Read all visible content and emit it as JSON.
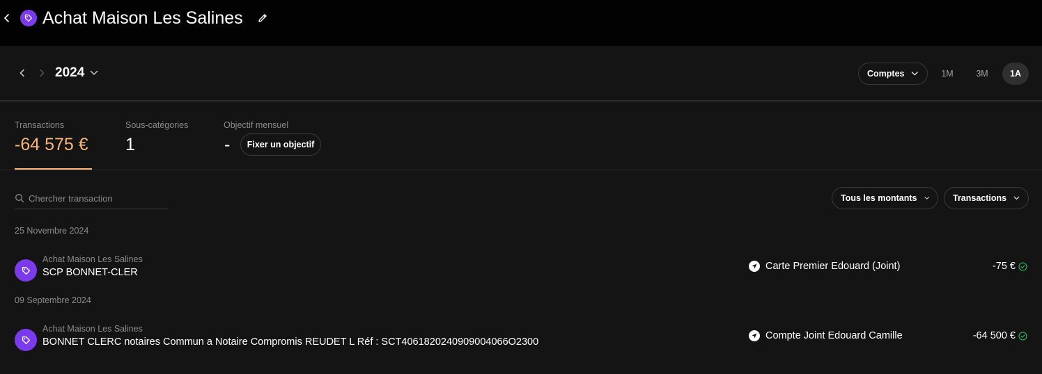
{
  "header": {
    "title": "Achat Maison Les Salines",
    "icon": "tag-icon",
    "accent_color": "#7c3aed"
  },
  "period": {
    "year": "2024",
    "accounts_filter": "Comptes",
    "options": [
      "1M",
      "3M",
      "1A"
    ],
    "active_option": "1A"
  },
  "stats": {
    "transactions_label": "Transactions",
    "transactions_value": "-64 575 €",
    "subcategories_label": "Sous-catégories",
    "subcategories_value": "1",
    "goal_label": "Objectif mensuel",
    "goal_value": "-",
    "goal_button": "Fixer un objectif",
    "amount_color": "#f9b57a"
  },
  "filters": {
    "search_placeholder": "Chercher transaction",
    "amounts": "Tous les montants",
    "type": "Transactions"
  },
  "groups": [
    {
      "date": "25 Novembre 2024",
      "transactions": [
        {
          "category": "Achat Maison Les Salines",
          "label": "SCP BONNET-CLER",
          "account": "Carte Premier Edouard (Joint)",
          "amount": "-75 €",
          "status": "check-circle-icon"
        }
      ]
    },
    {
      "date": "09 Septembre 2024",
      "transactions": [
        {
          "category": "Achat Maison Les Salines",
          "label": "BONNET CLERC notaires Commun a Notaire Compromis REUDET L Réf : SCT4061820240909004066O2300",
          "account": "Compte Joint Edouard Camille",
          "amount": "-64 500 €",
          "status": "check-circle-icon"
        }
      ]
    }
  ]
}
